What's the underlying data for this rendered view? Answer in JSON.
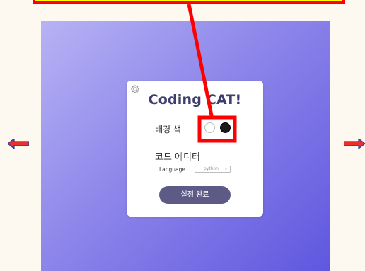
{
  "app": {
    "title": "Coding CAT!"
  },
  "settings": {
    "background_color_label": "배경 색",
    "color_options": [
      "white",
      "black"
    ],
    "selected_color": "black",
    "code_editor_heading": "코드 에디터",
    "language_label": "Language",
    "language_value": "python",
    "done_button_label": "설정 완료"
  },
  "navigation": {
    "prev_icon": "left-arrow-icon",
    "next_icon": "right-arrow-icon"
  },
  "annotation": {
    "highlight_color": "#ff0000"
  },
  "colors": {
    "gradient_start": "#b7b3f4",
    "gradient_end": "#5f57df",
    "title_color": "#3f3d6e",
    "button_color": "#5d5a86",
    "arrow_color": "#e8302c",
    "arrow_outline": "#2a3a9a"
  }
}
